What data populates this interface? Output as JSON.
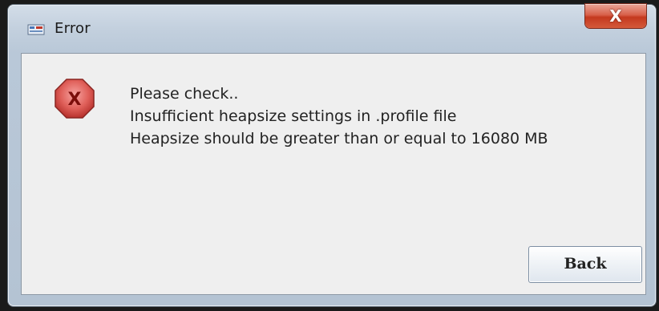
{
  "window": {
    "title": "Error",
    "close_label": "X",
    "title_icon": "java-app-icon"
  },
  "dialog": {
    "icon": "error-icon",
    "icon_glyph": "X",
    "icon_color": "#d9534f",
    "message_lines": [
      "Please check..",
      "Insufficient heapsize settings in .profile file",
      "Heapsize should be greater than or equal to 16080 MB"
    ],
    "back_label": "Back"
  }
}
